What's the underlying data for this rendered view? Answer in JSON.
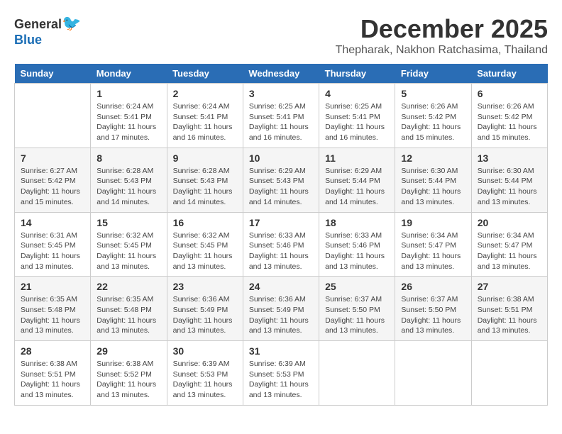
{
  "logo": {
    "general": "General",
    "blue": "Blue"
  },
  "title": "December 2025",
  "location": "Thepharak, Nakhon Ratchasima, Thailand",
  "days_header": [
    "Sunday",
    "Monday",
    "Tuesday",
    "Wednesday",
    "Thursday",
    "Friday",
    "Saturday"
  ],
  "weeks": [
    [
      {
        "day": "",
        "sunrise": "",
        "sunset": "",
        "daylight": ""
      },
      {
        "day": "1",
        "sunrise": "Sunrise: 6:24 AM",
        "sunset": "Sunset: 5:41 PM",
        "daylight": "Daylight: 11 hours and 17 minutes."
      },
      {
        "day": "2",
        "sunrise": "Sunrise: 6:24 AM",
        "sunset": "Sunset: 5:41 PM",
        "daylight": "Daylight: 11 hours and 16 minutes."
      },
      {
        "day": "3",
        "sunrise": "Sunrise: 6:25 AM",
        "sunset": "Sunset: 5:41 PM",
        "daylight": "Daylight: 11 hours and 16 minutes."
      },
      {
        "day": "4",
        "sunrise": "Sunrise: 6:25 AM",
        "sunset": "Sunset: 5:41 PM",
        "daylight": "Daylight: 11 hours and 16 minutes."
      },
      {
        "day": "5",
        "sunrise": "Sunrise: 6:26 AM",
        "sunset": "Sunset: 5:42 PM",
        "daylight": "Daylight: 11 hours and 15 minutes."
      },
      {
        "day": "6",
        "sunrise": "Sunrise: 6:26 AM",
        "sunset": "Sunset: 5:42 PM",
        "daylight": "Daylight: 11 hours and 15 minutes."
      }
    ],
    [
      {
        "day": "7",
        "sunrise": "Sunrise: 6:27 AM",
        "sunset": "Sunset: 5:42 PM",
        "daylight": "Daylight: 11 hours and 15 minutes."
      },
      {
        "day": "8",
        "sunrise": "Sunrise: 6:28 AM",
        "sunset": "Sunset: 5:43 PM",
        "daylight": "Daylight: 11 hours and 14 minutes."
      },
      {
        "day": "9",
        "sunrise": "Sunrise: 6:28 AM",
        "sunset": "Sunset: 5:43 PM",
        "daylight": "Daylight: 11 hours and 14 minutes."
      },
      {
        "day": "10",
        "sunrise": "Sunrise: 6:29 AM",
        "sunset": "Sunset: 5:43 PM",
        "daylight": "Daylight: 11 hours and 14 minutes."
      },
      {
        "day": "11",
        "sunrise": "Sunrise: 6:29 AM",
        "sunset": "Sunset: 5:44 PM",
        "daylight": "Daylight: 11 hours and 14 minutes."
      },
      {
        "day": "12",
        "sunrise": "Sunrise: 6:30 AM",
        "sunset": "Sunset: 5:44 PM",
        "daylight": "Daylight: 11 hours and 13 minutes."
      },
      {
        "day": "13",
        "sunrise": "Sunrise: 6:30 AM",
        "sunset": "Sunset: 5:44 PM",
        "daylight": "Daylight: 11 hours and 13 minutes."
      }
    ],
    [
      {
        "day": "14",
        "sunrise": "Sunrise: 6:31 AM",
        "sunset": "Sunset: 5:45 PM",
        "daylight": "Daylight: 11 hours and 13 minutes."
      },
      {
        "day": "15",
        "sunrise": "Sunrise: 6:32 AM",
        "sunset": "Sunset: 5:45 PM",
        "daylight": "Daylight: 11 hours and 13 minutes."
      },
      {
        "day": "16",
        "sunrise": "Sunrise: 6:32 AM",
        "sunset": "Sunset: 5:45 PM",
        "daylight": "Daylight: 11 hours and 13 minutes."
      },
      {
        "day": "17",
        "sunrise": "Sunrise: 6:33 AM",
        "sunset": "Sunset: 5:46 PM",
        "daylight": "Daylight: 11 hours and 13 minutes."
      },
      {
        "day": "18",
        "sunrise": "Sunrise: 6:33 AM",
        "sunset": "Sunset: 5:46 PM",
        "daylight": "Daylight: 11 hours and 13 minutes."
      },
      {
        "day": "19",
        "sunrise": "Sunrise: 6:34 AM",
        "sunset": "Sunset: 5:47 PM",
        "daylight": "Daylight: 11 hours and 13 minutes."
      },
      {
        "day": "20",
        "sunrise": "Sunrise: 6:34 AM",
        "sunset": "Sunset: 5:47 PM",
        "daylight": "Daylight: 11 hours and 13 minutes."
      }
    ],
    [
      {
        "day": "21",
        "sunrise": "Sunrise: 6:35 AM",
        "sunset": "Sunset: 5:48 PM",
        "daylight": "Daylight: 11 hours and 13 minutes."
      },
      {
        "day": "22",
        "sunrise": "Sunrise: 6:35 AM",
        "sunset": "Sunset: 5:48 PM",
        "daylight": "Daylight: 11 hours and 13 minutes."
      },
      {
        "day": "23",
        "sunrise": "Sunrise: 6:36 AM",
        "sunset": "Sunset: 5:49 PM",
        "daylight": "Daylight: 11 hours and 13 minutes."
      },
      {
        "day": "24",
        "sunrise": "Sunrise: 6:36 AM",
        "sunset": "Sunset: 5:49 PM",
        "daylight": "Daylight: 11 hours and 13 minutes."
      },
      {
        "day": "25",
        "sunrise": "Sunrise: 6:37 AM",
        "sunset": "Sunset: 5:50 PM",
        "daylight": "Daylight: 11 hours and 13 minutes."
      },
      {
        "day": "26",
        "sunrise": "Sunrise: 6:37 AM",
        "sunset": "Sunset: 5:50 PM",
        "daylight": "Daylight: 11 hours and 13 minutes."
      },
      {
        "day": "27",
        "sunrise": "Sunrise: 6:38 AM",
        "sunset": "Sunset: 5:51 PM",
        "daylight": "Daylight: 11 hours and 13 minutes."
      }
    ],
    [
      {
        "day": "28",
        "sunrise": "Sunrise: 6:38 AM",
        "sunset": "Sunset: 5:51 PM",
        "daylight": "Daylight: 11 hours and 13 minutes."
      },
      {
        "day": "29",
        "sunrise": "Sunrise: 6:38 AM",
        "sunset": "Sunset: 5:52 PM",
        "daylight": "Daylight: 11 hours and 13 minutes."
      },
      {
        "day": "30",
        "sunrise": "Sunrise: 6:39 AM",
        "sunset": "Sunset: 5:53 PM",
        "daylight": "Daylight: 11 hours and 13 minutes."
      },
      {
        "day": "31",
        "sunrise": "Sunrise: 6:39 AM",
        "sunset": "Sunset: 5:53 PM",
        "daylight": "Daylight: 11 hours and 13 minutes."
      },
      {
        "day": "",
        "sunrise": "",
        "sunset": "",
        "daylight": ""
      },
      {
        "day": "",
        "sunrise": "",
        "sunset": "",
        "daylight": ""
      },
      {
        "day": "",
        "sunrise": "",
        "sunset": "",
        "daylight": ""
      }
    ]
  ]
}
